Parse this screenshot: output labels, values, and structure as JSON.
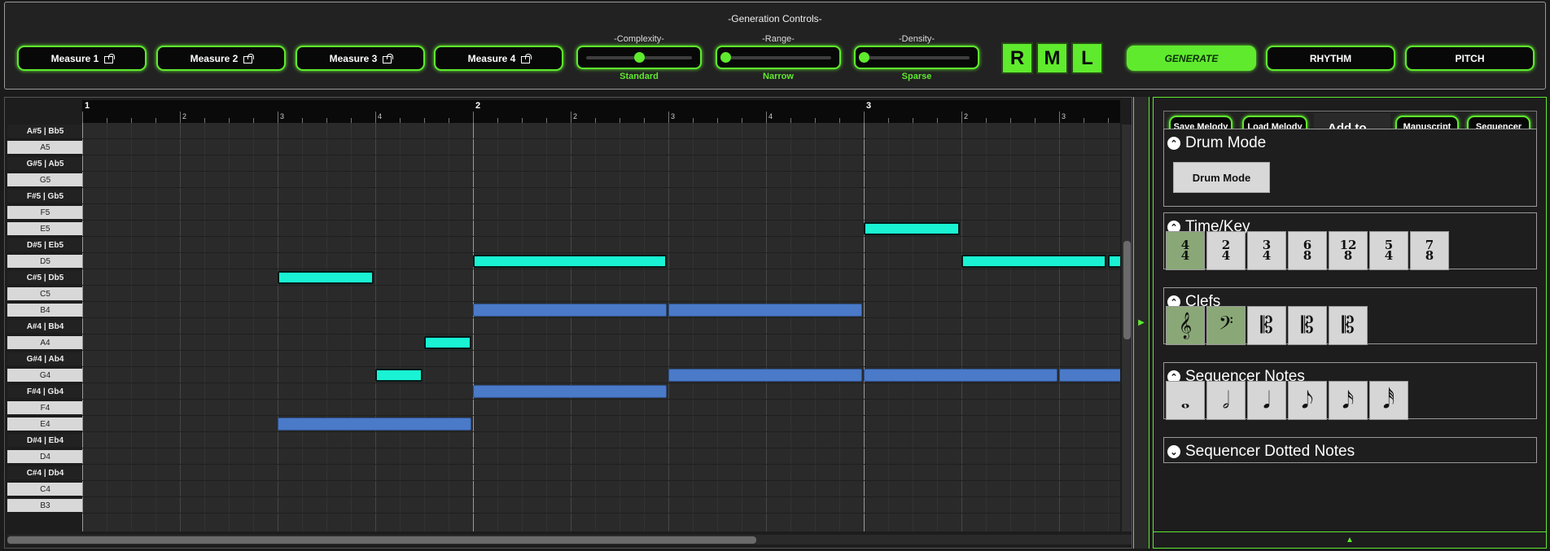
{
  "generation": {
    "title": "-Generation Controls-",
    "measures": [
      "Measure 1",
      "Measure 2",
      "Measure 3",
      "Measure 4"
    ],
    "sliders": [
      {
        "label": "-Complexity-",
        "value_label": "Standard",
        "level": 0.5
      },
      {
        "label": "-Range-",
        "value_label": "Narrow",
        "level": 0.0
      },
      {
        "label": "-Density-",
        "value_label": "Sparse",
        "level": 0.0
      }
    ],
    "rml": [
      "R",
      "M",
      "L"
    ],
    "actions": [
      "GENERATE",
      "RHYTHM",
      "PITCH"
    ],
    "accent_color": "#5fea2e"
  },
  "piano_roll": {
    "keys": [
      "A#5 | Bb5",
      "A5",
      "G#5 | Ab5",
      "G5",
      "F#5 | Gb5",
      "F5",
      "E5",
      "D#5 | Eb5",
      "D5",
      "C#5 | Db5",
      "C5",
      "B4",
      "A#4 | Bb4",
      "A4",
      "G#4 | Ab4",
      "G4",
      "F#4 | Gb4",
      "F4",
      "E4",
      "D#4 | Eb4",
      "D4",
      "C#4 | Db4",
      "C4",
      "B3"
    ],
    "bars": [
      "1",
      "2",
      "3"
    ],
    "beats": [
      "2",
      "3",
      "4"
    ],
    "melody_color": "#19f3d3",
    "accompaniment_color": "#4a7ac8",
    "notes": [
      {
        "pitch": "C#5 | Db5",
        "start": 2,
        "duration": 1,
        "kind": "melody"
      },
      {
        "pitch": "G4",
        "start": 3,
        "duration": 0.5,
        "kind": "melody"
      },
      {
        "pitch": "A4",
        "start": 3.5,
        "duration": 0.5,
        "kind": "melody"
      },
      {
        "pitch": "D5",
        "start": 4,
        "duration": 2,
        "kind": "melody"
      },
      {
        "pitch": "E5",
        "start": 8,
        "duration": 1,
        "kind": "melody"
      },
      {
        "pitch": "D5",
        "start": 9,
        "duration": 1.5,
        "kind": "melody"
      },
      {
        "pitch": "D5",
        "start": 10.5,
        "duration": 0.5,
        "kind": "melody"
      },
      {
        "pitch": "E4",
        "start": 2,
        "duration": 2,
        "kind": "accompaniment"
      },
      {
        "pitch": "B4",
        "start": 4,
        "duration": 2,
        "kind": "accompaniment"
      },
      {
        "pitch": "F#4 | Gb4",
        "start": 4,
        "duration": 2,
        "kind": "accompaniment"
      },
      {
        "pitch": "B4",
        "start": 6,
        "duration": 2,
        "kind": "accompaniment"
      },
      {
        "pitch": "G4",
        "start": 6,
        "duration": 2,
        "kind": "accompaniment"
      },
      {
        "pitch": "G4",
        "start": 8,
        "duration": 2,
        "kind": "accompaniment"
      },
      {
        "pitch": "G4",
        "start": 10,
        "duration": 1,
        "kind": "accompaniment"
      }
    ]
  },
  "side_panel": {
    "toolbar": {
      "save": "Save Melody",
      "load": "Load Melody",
      "add_to": "Add to...",
      "manuscript": "Manuscript",
      "sequencer": "Sequencer"
    },
    "drum_mode": {
      "title": "Drum Mode",
      "button": "Drum Mode"
    },
    "time_key": {
      "title": "Time/Key",
      "signatures": [
        {
          "top": "4",
          "bottom": "4",
          "selected": true
        },
        {
          "top": "2",
          "bottom": "4",
          "selected": false
        },
        {
          "top": "3",
          "bottom": "4",
          "selected": false
        },
        {
          "top": "6",
          "bottom": "8",
          "selected": false
        },
        {
          "top": "12",
          "bottom": "8",
          "selected": false
        },
        {
          "top": "5",
          "bottom": "4",
          "selected": false
        },
        {
          "top": "7",
          "bottom": "8",
          "selected": false
        }
      ]
    },
    "clefs": {
      "title": "Clefs",
      "items": [
        {
          "icon": "treble-clef-icon",
          "glyph": "𝄞",
          "selected": true
        },
        {
          "icon": "bass-clef-icon",
          "glyph": "𝄢",
          "selected": true
        },
        {
          "icon": "alto-clef-icon",
          "glyph": "𝄡",
          "selected": false
        },
        {
          "icon": "tenor-clef-icon",
          "glyph": "𝄡",
          "selected": false
        },
        {
          "icon": "c-clef-icon",
          "glyph": "𝄡",
          "selected": false
        }
      ]
    },
    "sequencer_notes": {
      "title": "Sequencer Notes",
      "items": [
        {
          "icon": "whole-note-icon",
          "glyph": "𝅝"
        },
        {
          "icon": "half-note-icon",
          "glyph": "𝅗𝅥"
        },
        {
          "icon": "quarter-note-icon",
          "glyph": "𝅘𝅥"
        },
        {
          "icon": "eighth-note-icon",
          "glyph": "𝅘𝅥𝅮"
        },
        {
          "icon": "sixteenth-note-icon",
          "glyph": "𝅘𝅥𝅯"
        },
        {
          "icon": "thirty-second-note-icon",
          "glyph": "𝅘𝅥𝅰"
        }
      ]
    },
    "dotted_notes": {
      "title": "Sequencer Dotted Notes"
    }
  }
}
